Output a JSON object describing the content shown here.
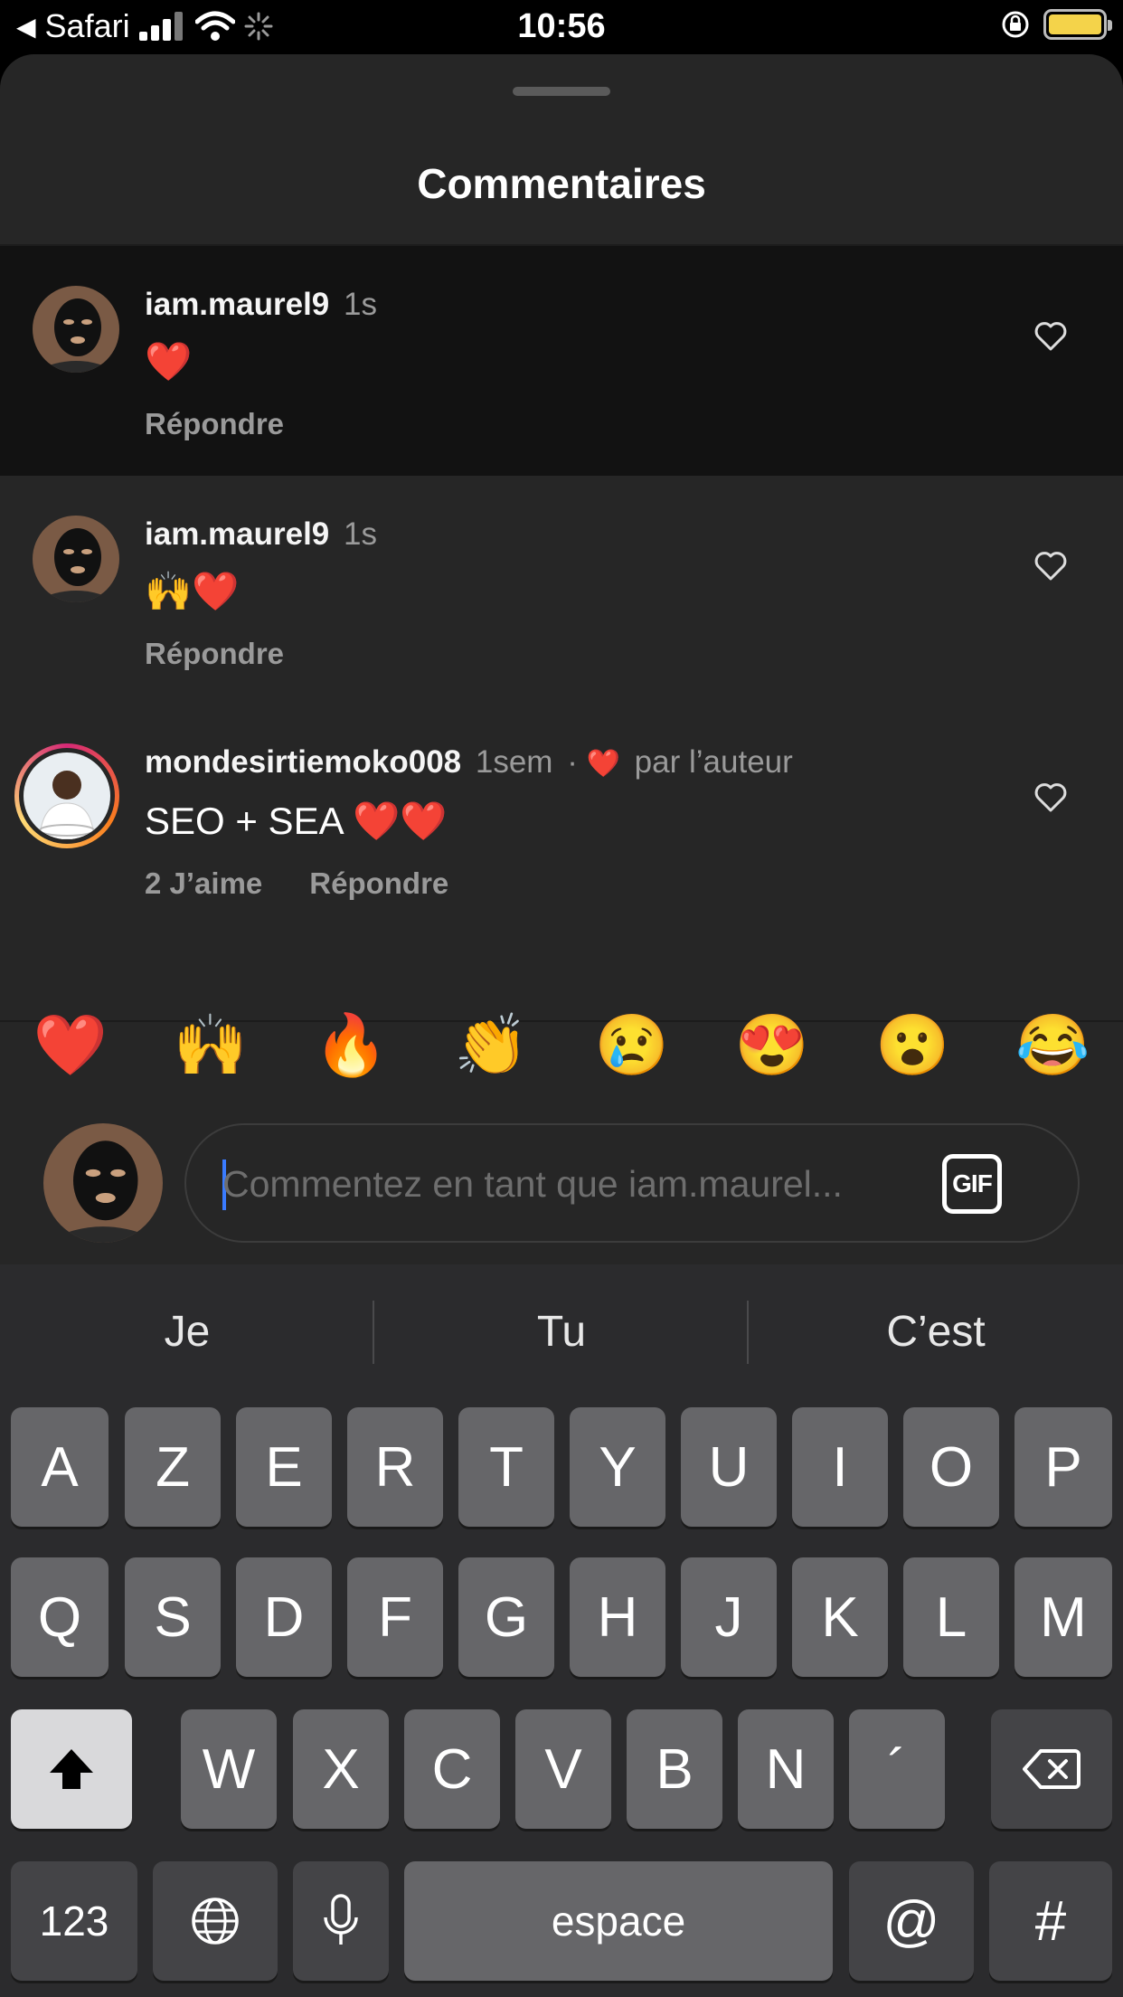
{
  "status_bar": {
    "back_app": "Safari",
    "time": "10:56"
  },
  "sheet": {
    "title": "Commentaires"
  },
  "comments": [
    {
      "user": "iam.maurel9",
      "time": "1s",
      "text": "❤️",
      "reply": "Répondre"
    },
    {
      "user": "iam.maurel9",
      "time": "1s",
      "text": "🙌❤️",
      "reply": "Répondre"
    },
    {
      "user": "mondesirtiemoko008",
      "time": "1sem",
      "meta_separator": "·",
      "author_heart": "❤️",
      "author_like": "par l’auteur",
      "text": "SEO + SEA ❤️❤️",
      "likes": "2 J’aime",
      "reply": "Répondre"
    }
  ],
  "emoji_bar": [
    "❤️",
    "🙌",
    "🔥",
    "👏",
    "😢",
    "😍",
    "😮",
    "😂"
  ],
  "composer": {
    "placeholder": "Commentez en tant que iam.maurel...",
    "gif_label": "GIF"
  },
  "keyboard": {
    "suggestions": [
      "Je",
      "Tu",
      "C’est"
    ],
    "row1": [
      "A",
      "Z",
      "E",
      "R",
      "T",
      "Y",
      "U",
      "I",
      "O",
      "P"
    ],
    "row2": [
      "Q",
      "S",
      "D",
      "F",
      "G",
      "H",
      "J",
      "K",
      "L",
      "M"
    ],
    "row3": [
      "W",
      "X",
      "C",
      "V",
      "B",
      "N",
      "´"
    ],
    "numbers_key": "123",
    "space_key": "espace",
    "at_key": "@",
    "hash_key": "#"
  },
  "colors": {
    "sheet_bg": "#262626",
    "highlight_bg": "#121212",
    "keyboard_bg": "#2b2b2d",
    "battery": "#f4d34a",
    "heart": "#ff3040",
    "caret": "#3a7bff"
  }
}
